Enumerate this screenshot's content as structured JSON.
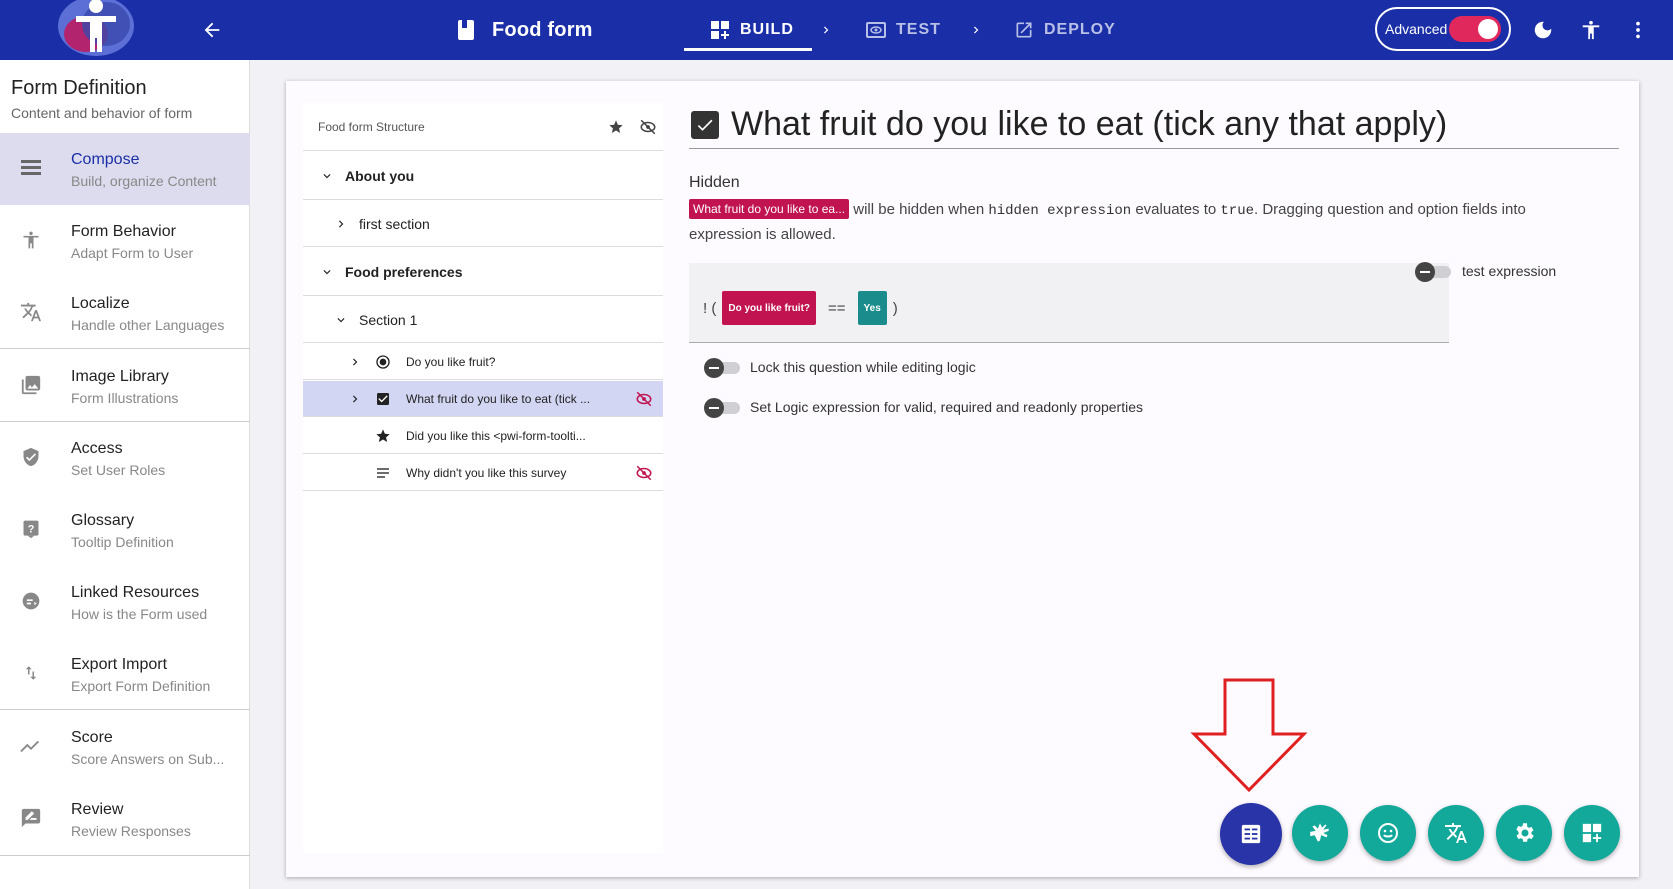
{
  "topbar": {
    "form_title": "Food form",
    "steps": [
      {
        "label": "BUILD",
        "active": true
      },
      {
        "label": "TEST",
        "active": false
      },
      {
        "label": "DEPLOY",
        "active": false
      }
    ],
    "advanced_label": "Advanced",
    "advanced_on": true,
    "icons": [
      "back-arrow-icon",
      "book-icon",
      "moon-icon",
      "accessibility-icon",
      "more-vert-icon"
    ]
  },
  "sidebar": {
    "title": "Form Definition",
    "subtitle": "Content and behavior of form",
    "items": [
      {
        "label": "Compose",
        "desc": "Build, organize Content",
        "icon": "compose-icon",
        "active": true
      },
      {
        "label": "Form Behavior",
        "desc": "Adapt Form to User",
        "icon": "accessibility-icon"
      },
      {
        "label": "Localize",
        "desc": "Handle other Languages",
        "icon": "translate-icon"
      },
      {
        "label": "Image Library",
        "desc": "Form Illustrations",
        "icon": "image-icon"
      },
      {
        "label": "Access",
        "desc": "Set User Roles",
        "icon": "shield-icon"
      },
      {
        "label": "Glossary",
        "desc": "Tooltip Definition",
        "icon": "help-icon"
      },
      {
        "label": "Linked Resources",
        "desc": "How is the Form used",
        "icon": "link-icon"
      },
      {
        "label": "Export Import",
        "desc": "Export Form Definition",
        "icon": "import-export-icon"
      },
      {
        "label": "Score",
        "desc": "Score Answers on Sub...",
        "icon": "trend-icon"
      },
      {
        "label": "Review",
        "desc": "Review Responses",
        "icon": "review-icon"
      }
    ]
  },
  "tree": {
    "header": "Food form Structure",
    "rows": [
      {
        "label": "About you",
        "type": "page"
      },
      {
        "label": "first section",
        "type": "section-collapsed"
      },
      {
        "label": "Food preferences",
        "type": "page"
      },
      {
        "label": "Section 1",
        "type": "section"
      },
      {
        "label": "Do you like fruit?",
        "type": "radio"
      },
      {
        "label": "What fruit do you like to eat (tick ...",
        "type": "checkbox",
        "selected": true,
        "hidden": true
      },
      {
        "label": "Did you like this <pwi-form-toolti...",
        "type": "rating"
      },
      {
        "label": "Why didn't you like this survey",
        "type": "text",
        "hidden": true
      }
    ]
  },
  "editor": {
    "title": "What fruit do you like to eat (tick any that apply)",
    "hidden_label": "Hidden",
    "chip": "What fruit do you like to ea...",
    "desc1": "will be hidden when",
    "code1": "hidden expression",
    "desc2": "evaluates to",
    "code2": "true",
    "desc3": ". Dragging question and option fields into expression is allowed.",
    "expr": {
      "not": "! (",
      "question": "Do you like fruit?",
      "op": "==",
      "answer": "Yes",
      "close": ")"
    },
    "test_expression": "test expression",
    "lock_label": "Lock this question while editing logic",
    "logic_label": "Set Logic expression for valid, required and readonly properties"
  },
  "fabs": [
    "form-view-icon",
    "sign-language-icon",
    "smiley-icon",
    "translate-icon",
    "settings-icon",
    "add-widget-icon"
  ],
  "colors": {
    "primary": "#1a2fa7",
    "accent": "#c1134f",
    "teal": "#12a89a",
    "toggle_on": "#e0285c"
  }
}
